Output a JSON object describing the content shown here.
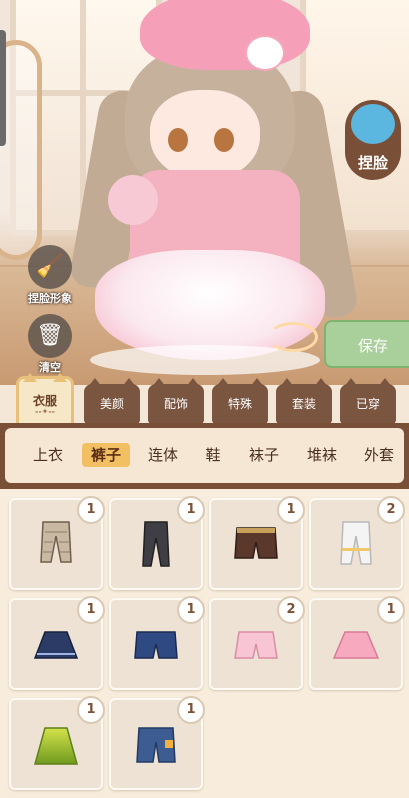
{
  "scene": {
    "pinch_face_label": "捏脸",
    "tools": [
      {
        "label": "捏脸形象",
        "icon": "broom-icon"
      },
      {
        "label": "清空",
        "icon": "trash-icon"
      }
    ],
    "save_label": "保存"
  },
  "categories": [
    {
      "label": "衣服",
      "active": true
    },
    {
      "label": "美颜"
    },
    {
      "label": "配饰"
    },
    {
      "label": "特殊"
    },
    {
      "label": "套装"
    },
    {
      "label": "已穿"
    }
  ],
  "subtabs": [
    {
      "label": "上衣"
    },
    {
      "label": "裤子",
      "active": true
    },
    {
      "label": "连体"
    },
    {
      "label": "鞋"
    },
    {
      "label": "袜子"
    },
    {
      "label": "堆袜"
    },
    {
      "label": "外套"
    }
  ],
  "items": [
    {
      "count": "1",
      "type": "plaid-capri-pants"
    },
    {
      "count": "1",
      "type": "black-pants"
    },
    {
      "count": "1",
      "type": "brown-shorts"
    },
    {
      "count": "2",
      "type": "white-lace-shorts"
    },
    {
      "count": "1",
      "type": "navy-pleated-skirt"
    },
    {
      "count": "1",
      "type": "denim-shorts"
    },
    {
      "count": "2",
      "type": "pink-ruffle-shorts"
    },
    {
      "count": "1",
      "type": "pink-pleated-skirt"
    },
    {
      "count": "1",
      "type": "green-gradient-skirt"
    },
    {
      "count": "1",
      "type": "patched-denim-shorts"
    }
  ],
  "colors": {
    "accent_brown": "#7a4f37",
    "active_tab": "#f3bf63",
    "save_green": "#a9cf9a"
  }
}
